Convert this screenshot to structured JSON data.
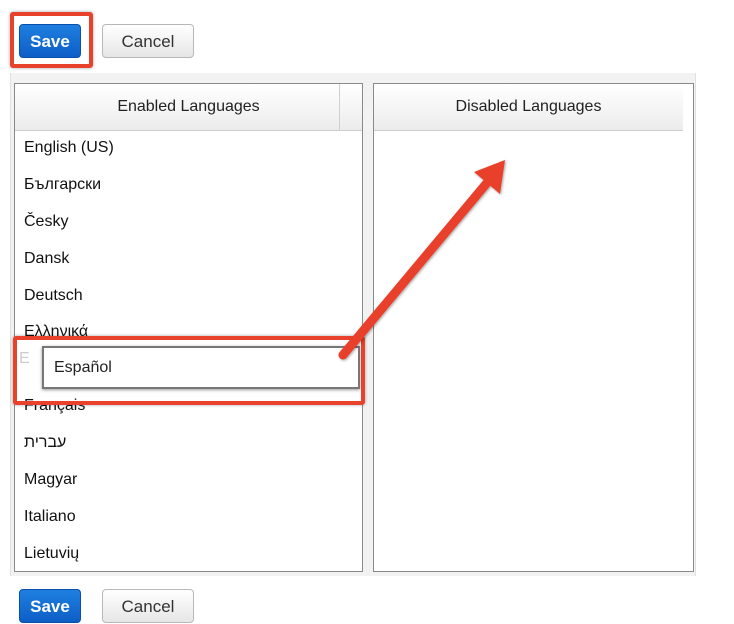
{
  "top_toolbar": {
    "save_label": "Save",
    "cancel_label": "Cancel"
  },
  "bottom_toolbar": {
    "save_label": "Save",
    "cancel_label": "Cancel"
  },
  "enabled_panel": {
    "header": "Enabled Languages",
    "items": [
      "English (US)",
      "Български",
      "Česky",
      "Dansk",
      "Deutsch",
      "Ελληνικά",
      "",
      "Français",
      "עברית",
      "Magyar",
      "Italiano",
      "Lietuvių"
    ]
  },
  "disabled_panel": {
    "header": "Disabled Languages"
  },
  "dragging_item": {
    "label": "Español",
    "ghost_initial": "E"
  },
  "colors": {
    "primary": "#1470d8",
    "annotation": "#e8412c"
  }
}
